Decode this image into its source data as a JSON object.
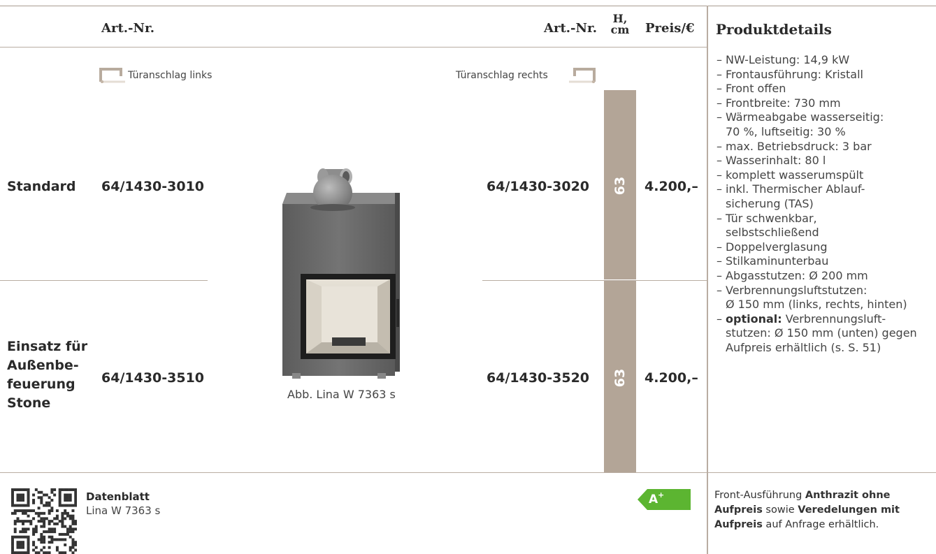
{
  "header": {
    "artnr_left": "Art.-Nr.",
    "artnr_right": "Art.-Nr.",
    "height_label_line1": "H,",
    "height_label_line2": "cm",
    "price_label": "Preis/€",
    "details_title": "Produktdetails"
  },
  "door": {
    "left_label": "Türanschlag links",
    "right_label": "Türanschlag rechts",
    "left_icon": "door-left-icon",
    "right_icon": "door-right-icon"
  },
  "rows": [
    {
      "label": "Standard",
      "artnr_left": "64/1430-3010",
      "artnr_right": "64/1430-3020",
      "height": "63",
      "price": "4.200,–"
    },
    {
      "label_lines": [
        "Einsatz für",
        "Außenbe-",
        "feuerung",
        "Stone"
      ],
      "artnr_left": "64/1430-3510",
      "artnr_right": "64/1430-3520",
      "height": "63",
      "price": "4.200,–"
    }
  ],
  "image_caption": "Abb. Lina W 7363 s",
  "details": [
    "NW-Leistung: 14,9 kW",
    "Frontausführung: Kristall",
    "Front offen",
    "Frontbreite: 730 mm",
    "Wärmeabgabe wasserseitig:",
    "70 %, luftseitig: 30 %",
    "max. Betriebsdruck: 3 bar",
    "Wasserinhalt: 80 l",
    "komplett wasserumspült",
    "inkl. Thermischer Ablauf-",
    "sicherung (TAS)",
    "Tür schwenkbar,",
    "selbstschließend",
    "Doppelverglasung",
    "Stilkaminunterbau",
    "Abgasstutzen: Ø 200 mm",
    "Verbrennungsluftstutzen:",
    "Ø 150 mm (links, rechts, hinten)",
    "Verbrennungsluft-",
    "stutzen: Ø 150 mm (unten) gegen",
    "Aufpreis erhältlich (s. S. 51)"
  ],
  "details_optional_prefix": "optional:",
  "footer": {
    "datasheet_title": "Datenblatt",
    "datasheet_model": "Lina W 7363 s",
    "energy_class": "A",
    "energy_class_sup": "+",
    "note_part1": "Front-Ausführung ",
    "note_bold1": "Anthrazit ohne Aufpreis",
    "note_part2": " sowie ",
    "note_bold2": "Veredelungen mit Aufpreis",
    "note_part3": " auf Anfrage erhältlich."
  },
  "colors": {
    "rule": "#b9ada2",
    "height_column": "#b3a597",
    "energy_label": "#5cb531"
  }
}
